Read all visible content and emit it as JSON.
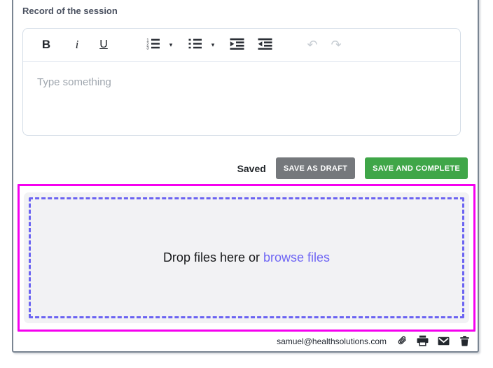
{
  "page": {
    "section_label": "Record of the session"
  },
  "editor": {
    "placeholder": "Type something",
    "toolbar": {
      "bold_label": "B",
      "italic_label": "i",
      "underline_label": "U",
      "caret_glyph": "▾",
      "undo_glyph": "↶",
      "redo_glyph": "↷",
      "icon_names": [
        "bold",
        "italic",
        "underline",
        "ordered-list",
        "unordered-list",
        "indent",
        "outdent",
        "undo",
        "redo"
      ]
    }
  },
  "actions": {
    "status_text": "Saved",
    "save_draft_label": "SAVE AS DRAFT",
    "save_complete_label": "SAVE AND COMPLETE"
  },
  "dropzone": {
    "prompt_text": "Drop files here or",
    "browse_label": "browse files"
  },
  "footer": {
    "email": "samuel@healthsolutions.com",
    "icon_names": [
      "paperclip",
      "printer",
      "envelope",
      "trash"
    ]
  },
  "colors": {
    "highlight_magenta": "#f500ef",
    "dashed_purple": "#6b63f2",
    "browse_link": "#6f66f4",
    "save_draft_bg": "#75787c",
    "save_complete_bg": "#3fa648",
    "frame_border": "#7a8592"
  }
}
